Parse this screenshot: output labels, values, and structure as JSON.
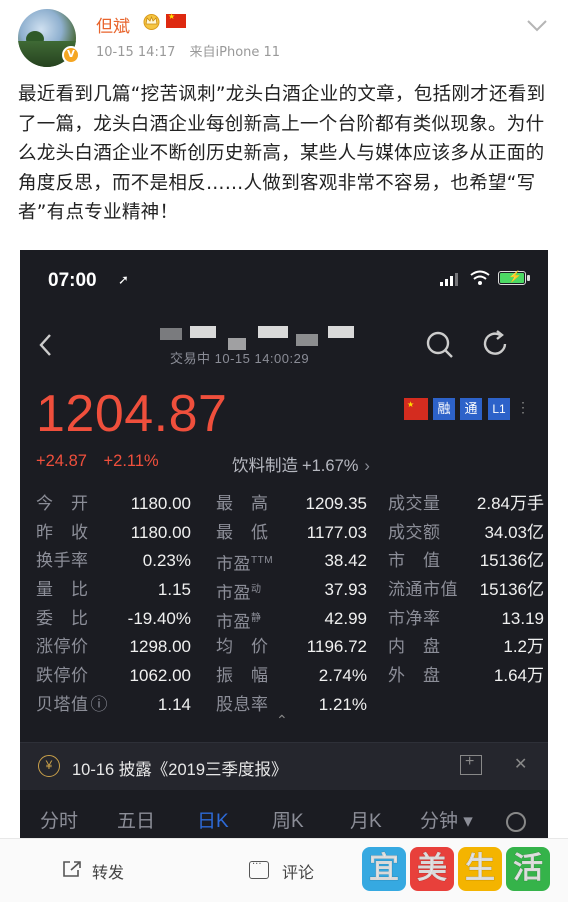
{
  "post": {
    "username": "但斌",
    "timestamp": "10-15 14:17",
    "source": "来自iPhone 11",
    "text": "最近看到几篇“挖苦讽刺”龙头白酒企业的文章，包括刚才还看到了一篇，龙头白酒企业每创新高上一个台阶都有类似现象。为什么龙头白酒企业不断创历史新高，某些人与媒体应该多从正面的角度反思，而不是相反……人做到客观非常不容易，也希望“写者”有点专业精神！"
  },
  "stock_app": {
    "status_time": "07:00",
    "trade_status": "交易中  10-15 14:00:29",
    "price": "1204.87",
    "change_abs": "+24.87",
    "change_pct": "+2.11%",
    "sector_name": "饮料制造",
    "sector_pct": "+1.67%",
    "sector_chevron": "›",
    "badges": {
      "rong": "融",
      "tong": "通",
      "level": "L1",
      "more": "⋮"
    },
    "quotes": [
      [
        {
          "label": "今　开",
          "value": "1180.00"
        },
        {
          "label": "最　高",
          "value": "1209.35"
        },
        {
          "label": "成交量",
          "value": "2.84万手"
        }
      ],
      [
        {
          "label": "昨　收",
          "value": "1180.00"
        },
        {
          "label": "最　低",
          "value": "1177.03"
        },
        {
          "label": "成交额",
          "value": "34.03亿"
        }
      ],
      [
        {
          "label": "换手率",
          "value": "0.23%"
        },
        {
          "label": "市盈",
          "sup": "TTM",
          "value": "38.42"
        },
        {
          "label": "市　值",
          "value": "15136亿"
        }
      ],
      [
        {
          "label": "量　比",
          "value": "1.15"
        },
        {
          "label": "市盈",
          "sup": "动",
          "value": "37.93"
        },
        {
          "label": "流通市值",
          "value": "15136亿"
        }
      ],
      [
        {
          "label": "委　比",
          "value": "-19.40%"
        },
        {
          "label": "市盈",
          "sup": "静",
          "value": "42.99"
        },
        {
          "label": "市净率",
          "value": "13.19"
        }
      ],
      [
        {
          "label": "涨停价",
          "value": "1298.00"
        },
        {
          "label": "均　价",
          "value": "1196.72"
        },
        {
          "label": "内　盘",
          "value": "1.2万"
        }
      ],
      [
        {
          "label": "跌停价",
          "value": "1062.00"
        },
        {
          "label": "振　幅",
          "value": "2.74%"
        },
        {
          "label": "外　盘",
          "value": "1.64万"
        }
      ],
      [
        {
          "label": "贝塔值",
          "suffix_icon": "ⓘ",
          "value": "1.14"
        },
        {
          "label": "股息率",
          "value": "1.21%"
        }
      ]
    ],
    "expand_glyph": "⌃",
    "notice": {
      "icon": "¥",
      "text": "10-16 披露《2019三季度报》",
      "close": "✕"
    },
    "tabs": [
      "分时",
      "五日",
      "日K",
      "周K",
      "月K",
      "分钟 ▾"
    ],
    "active_tab": 2
  },
  "actions": {
    "share_label": "转发",
    "comment_label": "评论"
  },
  "watermark": {
    "chars": [
      "宜",
      "美",
      "生",
      "活"
    ],
    "colors": [
      "#36a9e1",
      "#e8403b",
      "#f4b400",
      "#35b34a"
    ]
  },
  "colors": {
    "up": "#ef4f3c",
    "username": "#e8642c",
    "active_tab": "#2d6ad8"
  }
}
